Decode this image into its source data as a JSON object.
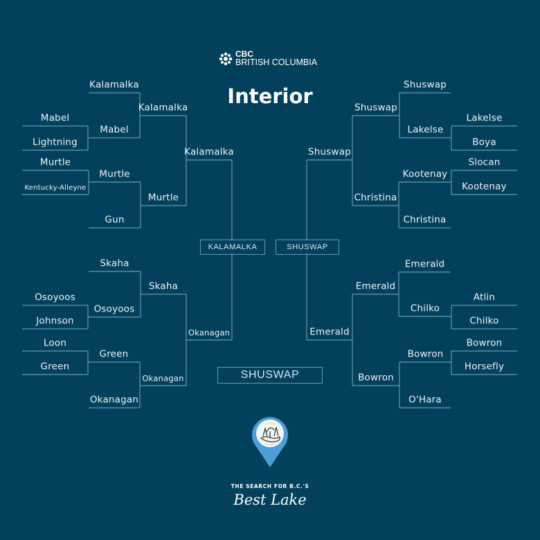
{
  "brand": {
    "line1": "CBC",
    "line2": "BRITISH COLUMBIA",
    "icon": "cbc-gem-icon"
  },
  "title": "Interior",
  "colors": {
    "background": "#03405c",
    "lines": "#5f9bb6",
    "text": "#eef4f7",
    "pin": "#4a9fd6"
  },
  "left": {
    "round1": [
      "Kalamalka",
      "Mabel",
      "Lightning",
      "Murtle",
      "Kentucky-Alleyne",
      "Gun",
      "Skaha",
      "Osoyoos",
      "Johnson",
      "Loon",
      "Green",
      "Okanagan"
    ],
    "round2": [
      "Kalamalka",
      "Mabel",
      "Murtle",
      "Gun",
      "Skaha",
      "Osoyoos",
      "Green",
      "Okanagan"
    ],
    "round3": [
      "Kalamalka",
      "Murtle",
      "Skaha",
      "Okanagan"
    ],
    "round4": [
      "Kalamalka",
      "Okanagan"
    ],
    "semifinal_winner": "KALAMALKA"
  },
  "right": {
    "round1": [
      "Shuswap",
      "Lakelse",
      "Boya",
      "Slocan",
      "Kootenay",
      "Christina",
      "Emerald",
      "Atlin",
      "Chilko",
      "Bowron",
      "Horsefly",
      "O'Hara"
    ],
    "round2": [
      "Shuswap",
      "Lakelse",
      "Kootenay",
      "Christina",
      "Emerald",
      "Chilko",
      "Bowron",
      "O'Hara"
    ],
    "round3": [
      "Shuswap",
      "Christina",
      "Emerald",
      "Bowron"
    ],
    "round4": [
      "Shuswap",
      "Emerald"
    ],
    "semifinal_winner": "SHUSWAP"
  },
  "champion": "SHUSWAP",
  "footer": {
    "tagline": "THE SEARCH FOR B.C.'S",
    "script": "Best Lake",
    "logo": "lake-map-pin-icon"
  }
}
